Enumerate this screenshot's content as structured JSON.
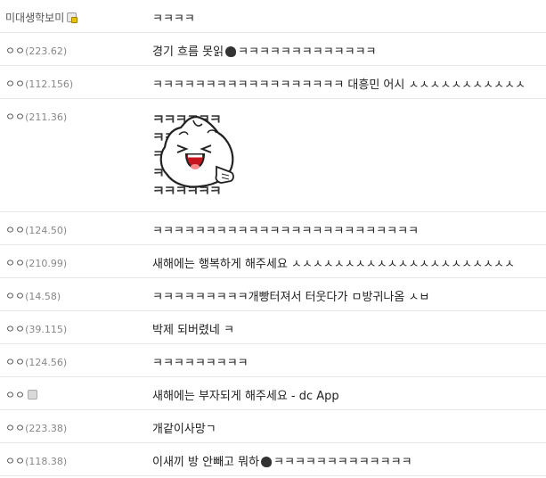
{
  "rows": [
    {
      "name": "미대생학보미",
      "ip": "",
      "badge": "fixed",
      "text": "ㅋㅋㅋㅋ"
    },
    {
      "name": "ㅇㅇ",
      "ip": "(223.62)",
      "text_before": "경기 흐름 못읽",
      "text_after": "ㅋㅋㅋㅋㅋㅋㅋㅋㅋㅋㅋㅋㅋ"
    },
    {
      "name": "ㅇㅇ",
      "ip": "(112.156)",
      "text": "ㅋㅋㅋㅋㅋㅋㅋㅋㅋㅋㅋㅋㅋㅋㅋㅋㅋㅋ 대흥민 어시 ㅅㅅㅅㅅㅅㅅㅅㅅㅅㅅㅅ"
    },
    {
      "name": "ㅇㅇ",
      "ip": "(211.36)",
      "sticker_text": "ㅋㅋㅋㅋㅋㅋ"
    },
    {
      "name": "ㅇㅇ",
      "ip": "(124.50)",
      "text": "ㅋㅋㅋㅋㅋㅋㅋㅋㅋㅋㅋㅋㅋㅋㅋㅋㅋㅋㅋㅋㅋㅋㅋㅋㅋ"
    },
    {
      "name": "ㅇㅇ",
      "ip": "(210.99)",
      "text": "새해에는 행복하게 해주세요 ㅅㅅㅅㅅㅅㅅㅅㅅㅅㅅㅅㅅㅅㅅㅅㅅㅅㅅㅅㅅㅅ"
    },
    {
      "name": "ㅇㅇ",
      "ip": "(14.58)",
      "text": "ㅋㅋㅋㅋㅋㅋㅋㅋㅋ개빵터져서 터웃다가 ㅁ방귀나옴 ㅅㅂ"
    },
    {
      "name": "ㅇㅇ",
      "ip": "(39.115)",
      "text": "박제 되버렸네 ㅋ"
    },
    {
      "name": "ㅇㅇ",
      "ip": "(124.56)",
      "text": "ㅋㅋㅋㅋㅋㅋㅋㅋㅋ"
    },
    {
      "name": "ㅇㅇ",
      "ip": "",
      "badge": "app",
      "text": "새해에는 부자되게 해주세요 - dc App"
    },
    {
      "name": "ㅇㅇ",
      "ip": "(223.38)",
      "text": "개같이사망ㄱ"
    },
    {
      "name": "ㅇㅇ",
      "ip": "(118.38)",
      "text_before": "이새끼 방 안빼고 뭐하",
      "text_after": "ㅋㅋㅋㅋㅋㅋㅋㅋㅋㅋㅋㅋㅋ"
    }
  ]
}
